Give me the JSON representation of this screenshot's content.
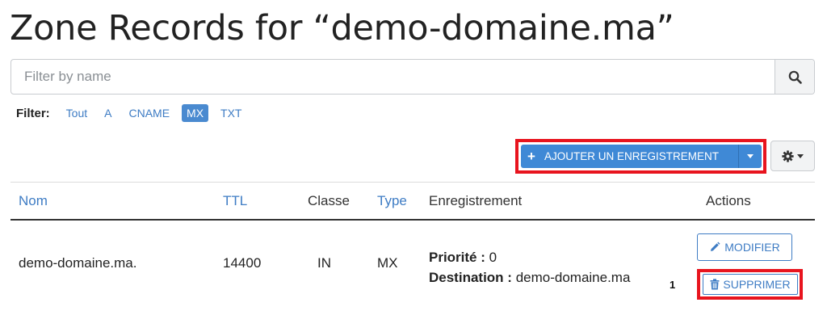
{
  "page": {
    "title": "Zone Records for “demo-domaine.ma”"
  },
  "search": {
    "placeholder": "Filter by name",
    "value": ""
  },
  "filter": {
    "label": "Filter:",
    "options": [
      "Tout",
      "A",
      "CNAME",
      "MX",
      "TXT"
    ],
    "selected": "MX"
  },
  "toolbar": {
    "add_label": "AJOUTER UN ENREGISTREMENT"
  },
  "table": {
    "headers": {
      "name": "Nom",
      "ttl": "TTL",
      "class": "Classe",
      "type": "Type",
      "record": "Enregistrement",
      "actions": "Actions"
    },
    "rows": [
      {
        "name": "demo-domaine.ma.",
        "ttl": "14400",
        "class": "IN",
        "type": "MX",
        "priority_label": "Priorité :",
        "priority": "0",
        "destination_label": "Destination :",
        "destination": "demo-domaine.ma",
        "edit_label": "MODIFIER",
        "delete_label": "SUPPRIMER"
      }
    ]
  },
  "annotation": {
    "marker": "1",
    "highlight_color": "#e8141e"
  },
  "colors": {
    "accent": "#3f89d6",
    "link": "#3e7cc4"
  },
  "icons": [
    "search-icon",
    "plus-icon",
    "caret-down-icon",
    "gear-icon",
    "pencil-icon",
    "trash-icon"
  ]
}
